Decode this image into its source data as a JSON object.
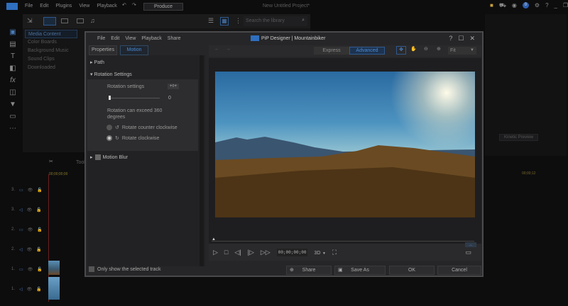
{
  "app": {
    "menu": [
      "File",
      "Edit",
      "Plugins",
      "View",
      "Playback"
    ],
    "produce": "Produce",
    "project_title": "New Untitled Project*",
    "notification_count": "0",
    "search_placeholder": "Search the library",
    "library_items": [
      "Media Content",
      "Color Boards",
      "Background Music",
      "Sound Clips",
      "Downloaded"
    ],
    "timecode": "00;00;00;00",
    "right_timecode": "00;00;12",
    "kinetic_preview": "Kinetic Preview",
    "tools_label": "Tools",
    "tracks": [
      "3.",
      "3.",
      "2.",
      "2.",
      "1.",
      "1."
    ]
  },
  "dialog": {
    "title": "PiP Designer | Mountainbiker",
    "menu": [
      "File",
      "Edit",
      "View",
      "Playback",
      "Share"
    ],
    "tabs": [
      "Properties",
      "Motion"
    ],
    "active_tab": "Motion",
    "sections": {
      "path": "Path",
      "rotation": "Rotation Settings",
      "motion_blur": "Motion Blur"
    },
    "rotation_label": "Rotation settings",
    "rotation_keyframe": "+◊+",
    "rotation_value": "0",
    "exceed_text": "Rotation can exceed 360 degrees",
    "options": [
      "Rotate counter clockwise",
      "Rotate clockwise"
    ],
    "selected_option": 1,
    "mode": [
      "Express",
      "Advanced"
    ],
    "active_mode": "Advanced",
    "zoom": "Fit",
    "player_time": "00;00;00;00",
    "three_d": "3D",
    "only_selected": "Only show the selected track",
    "buttons": {
      "share": "Share",
      "save_as": "Save As",
      "ok": "OK",
      "cancel": "Cancel"
    }
  }
}
